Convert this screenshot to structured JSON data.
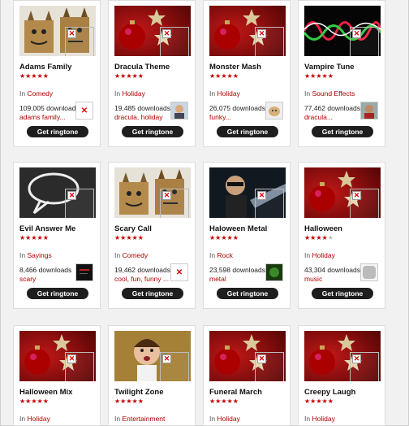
{
  "rows": [
    [
      {
        "title": "Adams Family",
        "stars": 5,
        "category_prefix": "In",
        "category": "Comedy",
        "downloads": "109,005 downloads",
        "tags": "adams family...",
        "thumb": "boxes",
        "avatar": "broken",
        "button": "Get ringtone"
      },
      {
        "title": "Dracula Theme",
        "stars": 5,
        "category_prefix": "In",
        "category": "Holiday",
        "downloads": "19,485 downloads",
        "tags": "dracula, holiday",
        "thumb": "xmas",
        "avatar": "person",
        "button": "Get ringtone"
      },
      {
        "title": "Monster Mash",
        "stars": 5,
        "category_prefix": "In",
        "category": "Holiday",
        "downloads": "26,075 downloads",
        "tags": "funky...",
        "thumb": "xmas",
        "avatar": "dog",
        "button": "Get ringtone"
      },
      {
        "title": "Vampire Tune",
        "stars": 5,
        "category_prefix": "In",
        "category": "Sound Effects",
        "downloads": "77,462 downloads",
        "tags": "dracula...",
        "thumb": "wave",
        "avatar": "person2",
        "button": "Get ringtone"
      }
    ],
    [
      {
        "title": "Evil Answer Me",
        "stars": 5,
        "category_prefix": "In",
        "category": "Sayings",
        "downloads": "8,466 downloads",
        "tags": "scary",
        "thumb": "bubble",
        "avatar": "dark",
        "button": "Get ringtone"
      },
      {
        "title": "Scary Call",
        "stars": 5,
        "category_prefix": "In",
        "category": "Comedy",
        "downloads": "19,462 downloads",
        "tags": "cool, fun, funny ...",
        "thumb": "boxes",
        "avatar": "broken",
        "button": "Get ringtone"
      },
      {
        "title": "Haloween Metal",
        "stars": 5,
        "category_prefix": "In",
        "category": "Rock",
        "downloads": "23,598 downloads",
        "tags": "metal",
        "thumb": "guitar",
        "avatar": "green",
        "button": "Get ringtone"
      },
      {
        "title": "Halloween",
        "stars": 4,
        "category_prefix": "In",
        "category": "Holiday",
        "downloads": "43,304 downloads",
        "tags": "music",
        "thumb": "xmas",
        "avatar": "grey",
        "button": "Get ringtone"
      }
    ],
    [
      {
        "title": "Halloween Mix",
        "stars": 5,
        "category_prefix": "In",
        "category": "Holiday",
        "thumb": "xmas"
      },
      {
        "title": "Twilight Zone",
        "stars": 5,
        "category_prefix": "In",
        "category": "Entertainment",
        "thumb": "kid"
      },
      {
        "title": "Funeral March",
        "stars": 5,
        "category_prefix": "In",
        "category": "Holiday",
        "thumb": "xmas"
      },
      {
        "title": "Creepy Laugh",
        "stars": 5,
        "category_prefix": "In",
        "category": "Holiday",
        "thumb": "xmas"
      }
    ]
  ],
  "colors": {
    "accent": "#b00000",
    "button_bg": "#1e1e1e",
    "star": "#c40000"
  }
}
